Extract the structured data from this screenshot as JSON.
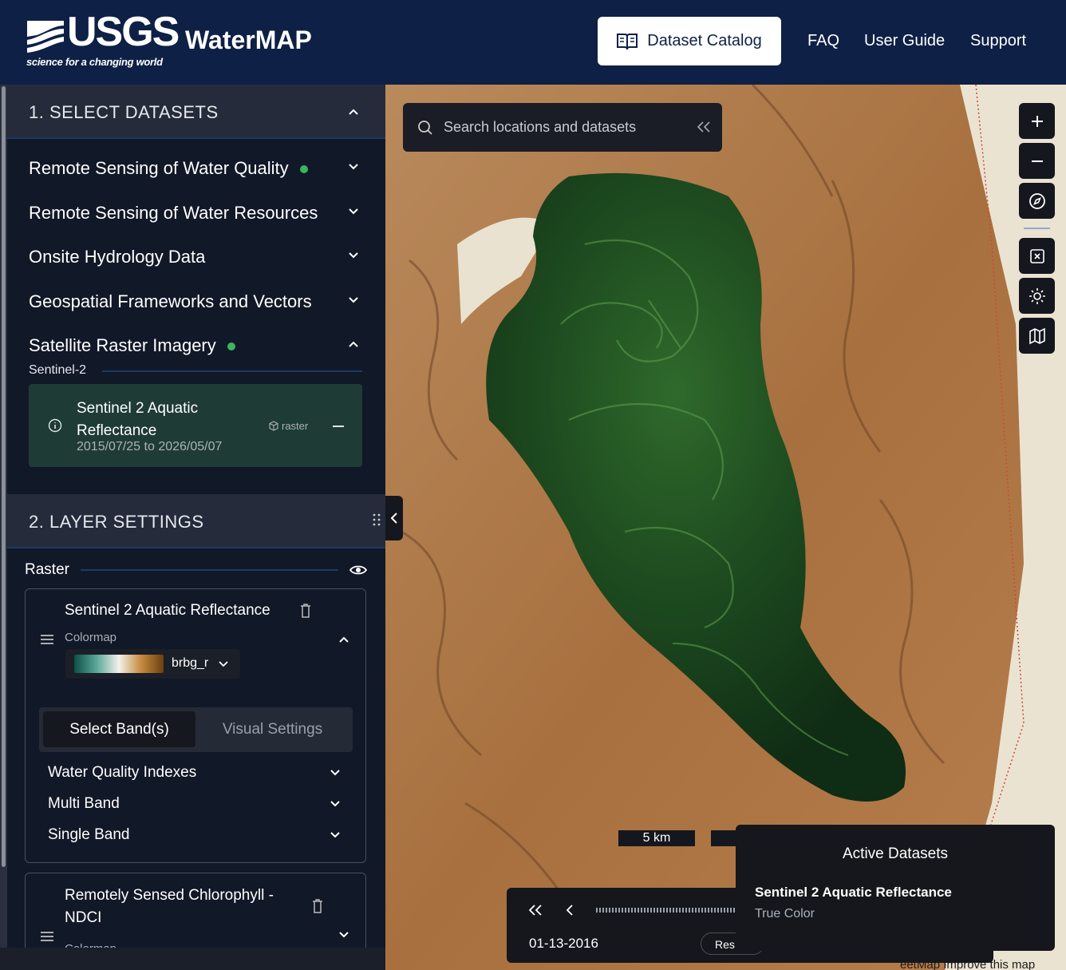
{
  "header": {
    "logo_word": "USGS",
    "logo_tagline": "science for a changing world",
    "app_title": "WaterMAP",
    "catalog_button": "Dataset Catalog",
    "nav": [
      "FAQ",
      "User Guide",
      "Support"
    ]
  },
  "select_datasets": {
    "title": "1. SELECT DATASETS",
    "categories": [
      {
        "label": "Remote Sensing of Water Quality",
        "active": true
      },
      {
        "label": "Remote Sensing of Water Resources",
        "active": false
      },
      {
        "label": "Onsite Hydrology Data",
        "active": false
      },
      {
        "label": "Geospatial Frameworks and Vectors",
        "active": false
      },
      {
        "label": "Satellite Raster Imagery",
        "active": true
      }
    ],
    "subgroup": "Sentinel-2",
    "dataset_card": {
      "name_line1": "Sentinel 2 Aquatic",
      "name_line2": "Reflectance",
      "dates": "2015/07/25 to 2026/05/07",
      "type": "raster"
    }
  },
  "layer_settings": {
    "title": "2. LAYER SETTINGS",
    "group_label": "Raster",
    "layers": [
      {
        "name": "Sentinel 2 Aquatic Reflectance",
        "colormap_label": "Colormap",
        "colormap_value": "brbg_r",
        "tabs": [
          "Select Band(s)",
          "Visual Settings"
        ],
        "band_groups": [
          "Water Quality Indexes",
          "Multi Band",
          "Single Band"
        ]
      },
      {
        "name_line1": "Remotely Sensed Chlorophyll -",
        "name_line2": "NDCI",
        "colormap_label": "Colormap"
      }
    ]
  },
  "map": {
    "search_placeholder": "Search locations and datasets",
    "scale_label": "5 km",
    "attribution": "eetMap  Improve this map",
    "active_datasets": {
      "title": "Active Datasets",
      "dataset": "Sentinel 2 Aquatic Reflectance",
      "style": "True Color"
    },
    "timeline": {
      "date": "01-13-2016",
      "reset_label": "Res"
    }
  },
  "colors": {
    "header_bg": "#0e2045",
    "sidebar_bg": "#111827",
    "accent_green": "#3cb55c",
    "card_bg": "#1f3b36"
  }
}
